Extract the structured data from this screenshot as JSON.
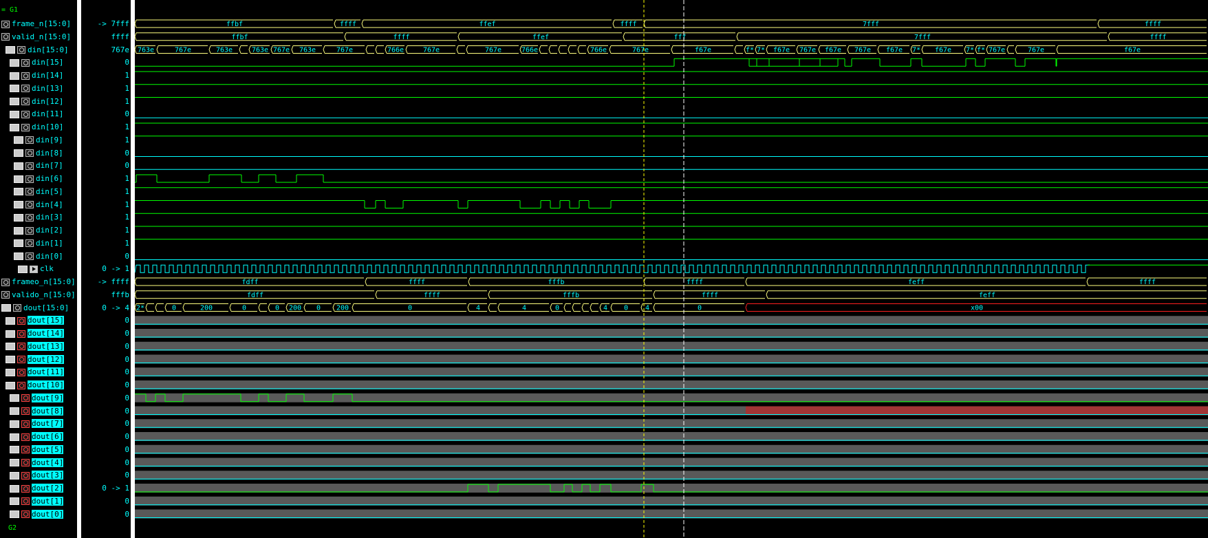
{
  "groups": {
    "top": "= G1",
    "bottom": "G2"
  },
  "signals": [
    {
      "name": "frame_n[15:0]",
      "value": "-> 7fff",
      "kind": "bus",
      "icons": [
        "file"
      ],
      "indent": 0,
      "segs": [
        [
          0,
          "ffbf"
        ],
        [
          290,
          "ffff"
        ],
        [
          330,
          "ffef"
        ],
        [
          695,
          "ffff"
        ],
        [
          740,
          "7fff"
        ],
        [
          1400,
          "ffff"
        ]
      ]
    },
    {
      "name": "valid_n[15:0]",
      "value": "ffff",
      "kind": "bus",
      "icons": [
        "file"
      ],
      "indent": 0,
      "segs": [
        [
          0,
          "ffbf"
        ],
        [
          305,
          "ffff"
        ],
        [
          470,
          "ffef"
        ],
        [
          710,
          "fff"
        ],
        [
          875,
          "7fff"
        ],
        [
          1415,
          "ffff"
        ]
      ]
    },
    {
      "name": "din[15:0]",
      "value": "767e",
      "kind": "bus",
      "icons": [
        "ver",
        "file"
      ],
      "indent": 1,
      "segs": [
        [
          0,
          "763e"
        ],
        [
          32,
          "767e"
        ],
        [
          108,
          "763e"
        ],
        [
          152,
          "7*"
        ],
        [
          166,
          "763e"
        ],
        [
          198,
          "767e"
        ],
        [
          228,
          "763e"
        ],
        [
          274,
          "767e"
        ],
        [
          336,
          "7*"
        ],
        [
          350,
          "7*"
        ],
        [
          364,
          "766e"
        ],
        [
          394,
          "767e"
        ],
        [
          468,
          "7*"
        ],
        [
          482,
          "767e"
        ],
        [
          560,
          "766e"
        ],
        [
          588,
          "7*"
        ],
        [
          602,
          "*"
        ],
        [
          616,
          "7*"
        ],
        [
          630,
          "7*"
        ],
        [
          644,
          "7*"
        ],
        [
          658,
          "766e"
        ],
        [
          690,
          "767e"
        ],
        [
          780,
          "f67e"
        ],
        [
          872,
          "7*"
        ],
        [
          886,
          "f*"
        ],
        [
          902,
          "7*"
        ],
        [
          918,
          "f67e"
        ],
        [
          962,
          "767e"
        ],
        [
          994,
          "f67e"
        ],
        [
          1036,
          "767e"
        ],
        [
          1080,
          "f67e"
        ],
        [
          1128,
          "7*"
        ],
        [
          1144,
          "f67e"
        ],
        [
          1206,
          "7*"
        ],
        [
          1222,
          "f*"
        ],
        [
          1238,
          "767e"
        ],
        [
          1268,
          "*"
        ],
        [
          1280,
          "767e"
        ],
        [
          1340,
          "f67e"
        ]
      ]
    },
    {
      "name": "din[15]",
      "value": "0",
      "kind": "bit",
      "icons": [
        "ver",
        "file"
      ],
      "indent": 2,
      "init": 0,
      "edges": [
        784,
        1022,
        893,
        904,
        922,
        966,
        996,
        1032,
        1042,
        1083,
        1128,
        1144,
        1208,
        1222,
        1236,
        1280,
        1294,
        1339,
        1340
      ]
    },
    {
      "name": "din[14]",
      "value": "1",
      "kind": "bit",
      "icons": [
        "ver",
        "file"
      ],
      "indent": 2,
      "init": 1,
      "edges": []
    },
    {
      "name": "din[13]",
      "value": "1",
      "kind": "bit",
      "icons": [
        "ver",
        "file"
      ],
      "indent": 2,
      "init": 1,
      "edges": []
    },
    {
      "name": "din[12]",
      "value": "1",
      "kind": "bit",
      "icons": [
        "ver",
        "file"
      ],
      "indent": 2,
      "init": 1,
      "edges": []
    },
    {
      "name": "din[11]",
      "value": "0",
      "kind": "bit",
      "icons": [
        "ver",
        "file"
      ],
      "indent": 2,
      "init": 0,
      "edges": []
    },
    {
      "name": "din[10]",
      "value": "1",
      "kind": "bit",
      "icons": [
        "ver",
        "file"
      ],
      "indent": 2,
      "init": 1,
      "edges": []
    },
    {
      "name": "din[9]",
      "value": "1",
      "kind": "bit",
      "icons": [
        "ver",
        "file"
      ],
      "indent": 3,
      "init": 1,
      "edges": []
    },
    {
      "name": "din[8]",
      "value": "0",
      "kind": "bit",
      "icons": [
        "ver",
        "file"
      ],
      "indent": 3,
      "init": 0,
      "edges": []
    },
    {
      "name": "din[7]",
      "value": "0",
      "kind": "bit",
      "icons": [
        "ver",
        "file"
      ],
      "indent": 3,
      "init": 0,
      "edges": []
    },
    {
      "name": "din[6]",
      "value": "1",
      "kind": "bit",
      "icons": [
        "ver",
        "file"
      ],
      "indent": 3,
      "init": 0,
      "edges": [
        2,
        32,
        108,
        155,
        180,
        205,
        235,
        274
      ]
    },
    {
      "name": "din[5]",
      "value": "1",
      "kind": "bit",
      "icons": [
        "ver",
        "file"
      ],
      "indent": 3,
      "init": 1,
      "edges": []
    },
    {
      "name": "din[4]",
      "value": "1",
      "kind": "bit",
      "icons": [
        "ver",
        "file"
      ],
      "indent": 3,
      "init": 1,
      "edges": [
        334,
        350,
        364,
        390,
        470,
        484,
        560,
        590,
        604,
        618,
        632,
        646,
        660,
        692
      ]
    },
    {
      "name": "din[3]",
      "value": "1",
      "kind": "bit",
      "icons": [
        "ver",
        "file"
      ],
      "indent": 3,
      "init": 1,
      "edges": []
    },
    {
      "name": "din[2]",
      "value": "1",
      "kind": "bit",
      "icons": [
        "ver",
        "file"
      ],
      "indent": 3,
      "init": 1,
      "edges": []
    },
    {
      "name": "din[1]",
      "value": "1",
      "kind": "bit",
      "icons": [
        "ver",
        "file"
      ],
      "indent": 3,
      "init": 1,
      "edges": []
    },
    {
      "name": "din[0]",
      "value": "0",
      "kind": "bit",
      "icons": [
        "ver",
        "file"
      ],
      "indent": 3,
      "init": 0,
      "edges": []
    },
    {
      "name": "clk",
      "value": "0 -> 1",
      "kind": "clock",
      "icons": [
        "ver",
        "clock"
      ],
      "indent": 4,
      "stop": 1385
    },
    {
      "name": "frameo_n[15:0]",
      "value": "-> ffff",
      "kind": "bus",
      "icons": [
        "file"
      ],
      "indent": 0,
      "segs": [
        [
          0,
          "fdff"
        ],
        [
          335,
          "ffff"
        ],
        [
          485,
          "fffb"
        ],
        [
          740,
          "ffff"
        ],
        [
          888,
          "feff"
        ],
        [
          1384,
          "ffff"
        ]
      ]
    },
    {
      "name": "valido_n[15:0]",
      "value": "fffb",
      "kind": "bus",
      "icons": [
        "file"
      ],
      "indent": 0,
      "segs": [
        [
          0,
          "fdff"
        ],
        [
          350,
          "ffff"
        ],
        [
          514,
          "fffb"
        ],
        [
          754,
          "ffff"
        ],
        [
          918,
          "feff"
        ]
      ]
    },
    {
      "name": "dout[15:0]",
      "value": "0 -> 4",
      "kind": "bus",
      "icons": [
        "ver",
        "file"
      ],
      "indent": 0,
      "red_from": 888,
      "segs": [
        [
          0,
          "2*"
        ],
        [
          16,
          "0"
        ],
        [
          30,
          "2*"
        ],
        [
          44,
          "0"
        ],
        [
          70,
          "200"
        ],
        [
          138,
          "0"
        ],
        [
          180,
          "2*"
        ],
        [
          194,
          "0"
        ],
        [
          220,
          "200"
        ],
        [
          246,
          "0"
        ],
        [
          288,
          "200"
        ],
        [
          316,
          "0"
        ],
        [
          484,
          "4"
        ],
        [
          514,
          "0"
        ],
        [
          528,
          "4"
        ],
        [
          604,
          "0"
        ],
        [
          624,
          "4"
        ],
        [
          636,
          "0"
        ],
        [
          650,
          "4"
        ],
        [
          662,
          "0"
        ],
        [
          676,
          "4"
        ],
        [
          692,
          "0"
        ],
        [
          736,
          "4"
        ],
        [
          754,
          "0"
        ],
        [
          888,
          "x00"
        ]
      ]
    },
    {
      "name": "dout[15]",
      "value": "0",
      "kind": "out",
      "icons": [
        "ver",
        "red"
      ],
      "indent": 1,
      "init": 0,
      "edges": []
    },
    {
      "name": "dout[14]",
      "value": "0",
      "kind": "out",
      "icons": [
        "ver",
        "red"
      ],
      "indent": 1,
      "init": 0,
      "edges": []
    },
    {
      "name": "dout[13]",
      "value": "0",
      "kind": "out",
      "icons": [
        "ver",
        "red"
      ],
      "indent": 1,
      "init": 0,
      "edges": []
    },
    {
      "name": "dout[12]",
      "value": "0",
      "kind": "out",
      "icons": [
        "ver",
        "red"
      ],
      "indent": 1,
      "init": 0,
      "edges": []
    },
    {
      "name": "dout[11]",
      "value": "0",
      "kind": "out",
      "icons": [
        "ver",
        "red"
      ],
      "indent": 1,
      "init": 0,
      "edges": []
    },
    {
      "name": "dout[10]",
      "value": "0",
      "kind": "out",
      "icons": [
        "ver",
        "red"
      ],
      "indent": 1,
      "init": 0,
      "edges": []
    },
    {
      "name": "dout[9]",
      "value": "0",
      "kind": "out",
      "icons": [
        "ver",
        "red"
      ],
      "indent": 2,
      "init": 1,
      "edges": [
        16,
        30,
        44,
        70,
        154,
        180,
        194,
        220,
        246,
        288,
        316
      ]
    },
    {
      "name": "dout[8]",
      "value": "0",
      "kind": "out",
      "icons": [
        "ver",
        "red"
      ],
      "indent": 2,
      "init": 0,
      "edges": [],
      "red_from": 888
    },
    {
      "name": "dout[7]",
      "value": "0",
      "kind": "out",
      "icons": [
        "ver",
        "red"
      ],
      "indent": 2,
      "init": 0,
      "edges": []
    },
    {
      "name": "dout[6]",
      "value": "0",
      "kind": "out",
      "icons": [
        "ver",
        "red"
      ],
      "indent": 2,
      "init": 0,
      "edges": []
    },
    {
      "name": "dout[5]",
      "value": "0",
      "kind": "out",
      "icons": [
        "ver",
        "red"
      ],
      "indent": 2,
      "init": 0,
      "edges": []
    },
    {
      "name": "dout[4]",
      "value": "0",
      "kind": "out",
      "icons": [
        "ver",
        "red"
      ],
      "indent": 2,
      "init": 0,
      "edges": []
    },
    {
      "name": "dout[3]",
      "value": "0",
      "kind": "out",
      "icons": [
        "ver",
        "red"
      ],
      "indent": 2,
      "init": 0,
      "edges": []
    },
    {
      "name": "dout[2]",
      "value": "0 -> 1",
      "kind": "out",
      "icons": [
        "ver",
        "red"
      ],
      "indent": 2,
      "init": 0,
      "edges": [
        484,
        514,
        528,
        604,
        624,
        636,
        650,
        662,
        676,
        692,
        736,
        754
      ]
    },
    {
      "name": "dout[1]",
      "value": "0",
      "kind": "out",
      "icons": [
        "ver",
        "red"
      ],
      "indent": 2,
      "init": 0,
      "edges": []
    },
    {
      "name": "dout[0]",
      "value": "0",
      "kind": "out",
      "icons": [
        "ver",
        "red"
      ],
      "indent": 2,
      "init": 0,
      "edges": []
    }
  ],
  "colors": {
    "bg": "#000000",
    "bit": "#00ff00",
    "zero": "#00ffff",
    "bus": "#ffff80",
    "text": "#00ffff",
    "unknown": "#ff2020",
    "out_fill": "#595959",
    "cursor_primary": "#ffffff",
    "cursor_secondary": "#ffff00"
  },
  "cursors": {
    "primary": 798,
    "secondary": 740
  }
}
